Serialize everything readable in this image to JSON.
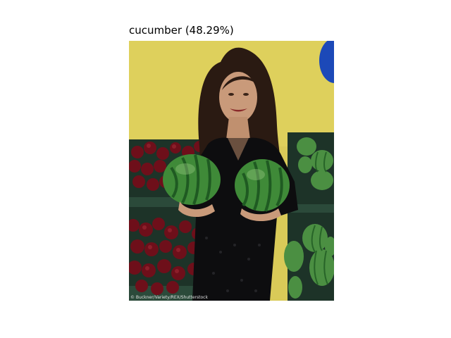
{
  "caption": {
    "label": "cucumber",
    "confidence": "(48.29%)"
  },
  "photo": {
    "credit": "© Buckner/Variety/REX/Shutterstock",
    "colors": {
      "wall": "#d9ca58",
      "crate": "#213a30",
      "apple": "#6e0f1a",
      "watermelon": "#3f8a38",
      "watermelon_stripe": "#1f5a22",
      "hair": "#2a1a12",
      "skin": "#c99a7a",
      "dress": "#0d0d0f",
      "balloon": "#1c49b8"
    },
    "objects": [
      "wall",
      "balloon",
      "apple-crates",
      "watermelon-crates",
      "woman",
      "watermelon-left",
      "watermelon-right"
    ]
  }
}
